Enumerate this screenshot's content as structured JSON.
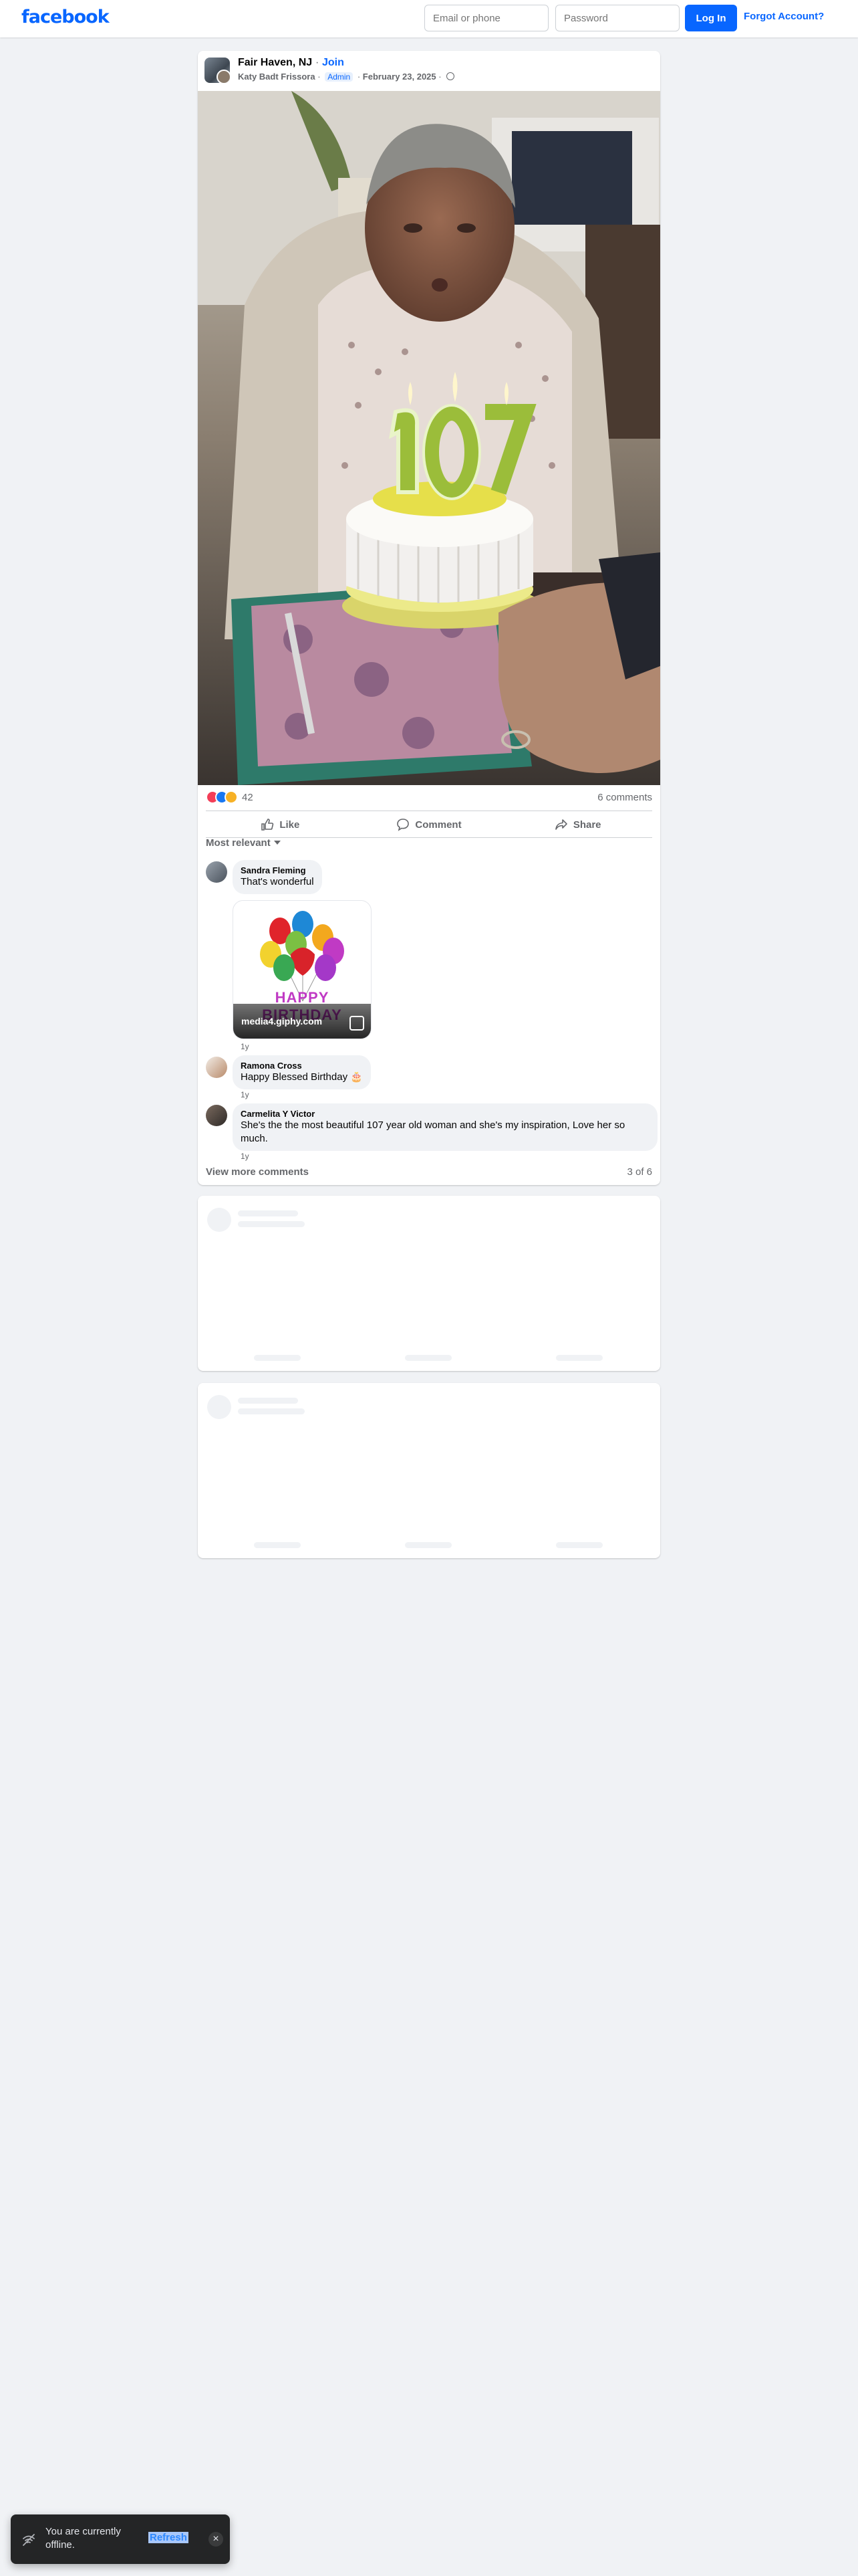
{
  "header": {
    "logo": "facebook",
    "email_placeholder": "Email or phone",
    "password_placeholder": "Password",
    "login_label": "Log In",
    "forgot_label": "Forgot Account?"
  },
  "post": {
    "group_name": "Fair Haven, NJ",
    "join_label": "Join",
    "separator": "·",
    "author": "Katy Badt Frissora",
    "role_badge": "Admin",
    "date": "February 23, 2025",
    "privacy_icon": "globe-icon",
    "reaction_types": [
      "love",
      "like",
      "care"
    ],
    "reaction_count": "42",
    "comments_count": "6 comments",
    "actions": {
      "like": "Like",
      "comment": "Comment",
      "share": "Share"
    },
    "sort_label": "Most relevant",
    "comments": [
      {
        "name": "Sandra Fleming",
        "text": "That's wonderful",
        "gif_source": "media4.giphy.com",
        "gif_text": "HAPPY BIRTHDAY",
        "time": "1y"
      },
      {
        "name": "Ramona Cross",
        "text": "Happy Blessed Birthday 🎂",
        "time": "1y"
      },
      {
        "name": "Carmelita Y Victor",
        "text": "She's the the most beautiful 107 year old woman and she's my inspiration, Love her so much.",
        "time": "1y"
      }
    ],
    "view_more_label": "View more comments",
    "page_indicator": "3 of 6"
  },
  "toast": {
    "message": "You are currently offline.",
    "refresh_label": "Refresh",
    "close_icon": "close-icon"
  },
  "colors": {
    "brand": "#0866ff",
    "background": "#f0f2f5",
    "secondary_text": "#65676b"
  }
}
